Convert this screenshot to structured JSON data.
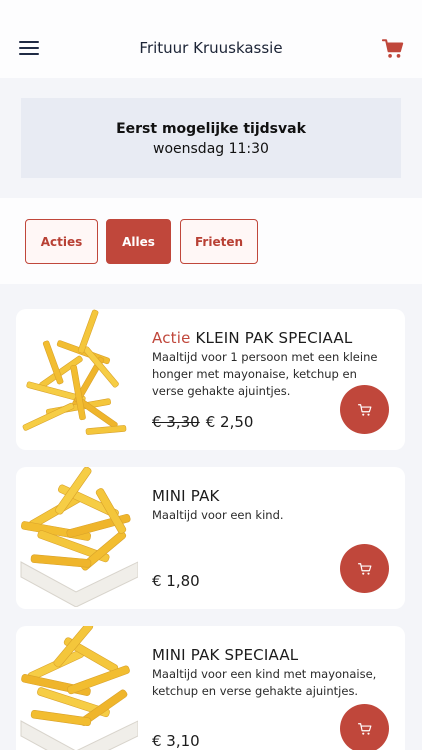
{
  "header": {
    "title": "Frituur Kruuskassie",
    "menu_icon": "hamburger-menu-icon",
    "cart_icon": "shopping-cart-icon"
  },
  "timeslot": {
    "title": "Eerst mogelijke tijdsvak",
    "value": "woensdag 11:30"
  },
  "filters": [
    {
      "label": "Acties",
      "active": false
    },
    {
      "label": "Alles",
      "active": true
    },
    {
      "label": "Frieten",
      "active": false
    }
  ],
  "products": [
    {
      "promo_label": "Actie",
      "name": "KLEIN PAK SPECIAAL",
      "description": "Maaltijd voor 1 persoon met een kleine honger met mayonaise, ketchup en verse gehakte ajuintjes.",
      "old_price": "€ 3,30",
      "price": "€ 2,50"
    },
    {
      "name": "MINI PAK",
      "description": "Maaltijd voor een kind.",
      "price": "€ 1,80"
    },
    {
      "name": "MINI PAK SPECIAAL",
      "description": "Maaltijd voor een kind met mayonaise, ketchup en verse gehakte ajuintjes.",
      "price": "€ 3,10"
    }
  ],
  "colors": {
    "accent": "#c0473b",
    "background": "#f4f5f9",
    "timeslot_box": "#e8ebf3",
    "title_text": "#1c2436"
  }
}
